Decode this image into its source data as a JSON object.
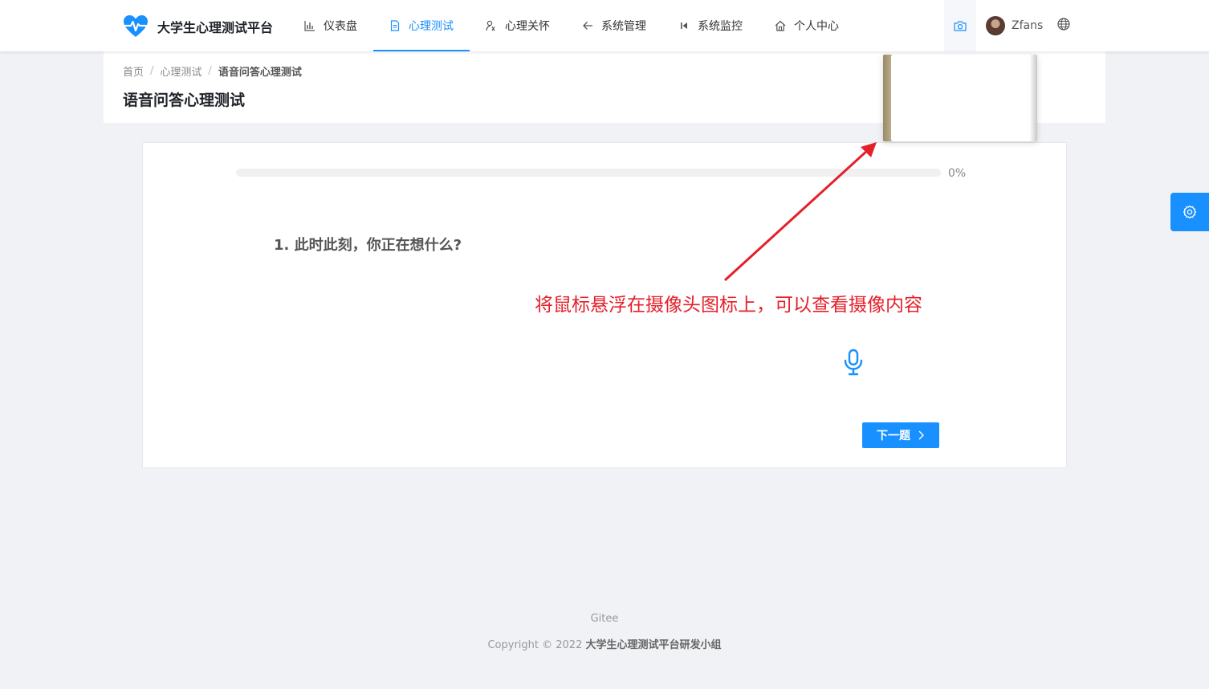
{
  "app": {
    "title": "大学生心理测试平台",
    "accent": "#1890ff"
  },
  "nav": {
    "items": [
      {
        "label": "仪表盘",
        "icon": "bar-chart-icon"
      },
      {
        "label": "心理测试",
        "icon": "document-icon",
        "active": true
      },
      {
        "label": "心理关怀",
        "icon": "care-icon"
      },
      {
        "label": "系统管理",
        "icon": "arrow-left-icon"
      },
      {
        "label": "系统监控",
        "icon": "skip-back-icon"
      },
      {
        "label": "个人中心",
        "icon": "home-icon"
      }
    ]
  },
  "header": {
    "username": "Zfans",
    "camera_icon": "camera-icon",
    "language_icon": "globe-icon"
  },
  "breadcrumb": {
    "home": "首页",
    "section": "心理测试",
    "current": "语音问答心理测试",
    "separator": "/"
  },
  "page": {
    "title": "语音问答心理测试"
  },
  "test": {
    "progress_percent": 0,
    "progress_text": "0%",
    "question": "1. 此时此刻，你正在想什么?",
    "next_label": "下一题"
  },
  "annotation": {
    "text": "将鼠标悬浮在摄像头图标上，可以查看摄像内容",
    "color": "#e4202a"
  },
  "footer": {
    "link": "Gitee",
    "copyright_prefix": "Copyright © 2022 ",
    "copyright_org": "大学生心理测试平台研发小组"
  }
}
